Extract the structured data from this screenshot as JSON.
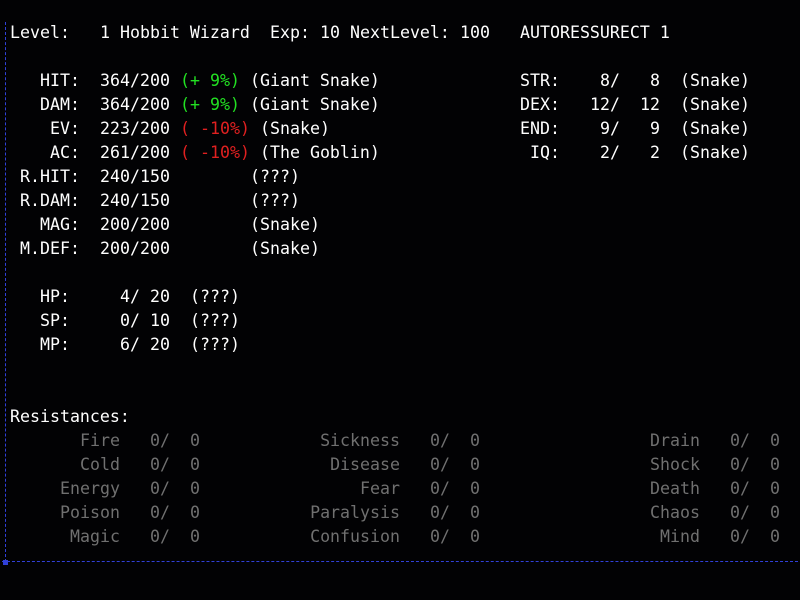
{
  "header": {
    "level_label": "Level:",
    "level_value": "1",
    "race_class": "Hobbit Wizard",
    "exp_label": "Exp:",
    "exp_value": "10",
    "next_label": "NextLevel:",
    "next_value": "100",
    "autores": "AUTORESSURECT 1"
  },
  "combat": [
    {
      "label": "HIT:",
      "cur": "364/",
      "max": "200",
      "mod": "(+ 9%)",
      "mod_color": "green",
      "src": "(Giant Snake)"
    },
    {
      "label": "DAM:",
      "cur": "364/",
      "max": "200",
      "mod": "(+ 9%)",
      "mod_color": "green",
      "src": "(Giant Snake)"
    },
    {
      "label": "EV:",
      "cur": "223/",
      "max": "200",
      "mod": "( -10%)",
      "mod_color": "red",
      "src": "(Snake)"
    },
    {
      "label": "AC:",
      "cur": "261/",
      "max": "200",
      "mod": "( -10%)",
      "mod_color": "red",
      "src": "(The Goblin)"
    },
    {
      "label": "R.HIT:",
      "cur": "240/",
      "max": "150",
      "mod": "",
      "mod_color": "",
      "src": "(???)"
    },
    {
      "label": "R.DAM:",
      "cur": "240/",
      "max": "150",
      "mod": "",
      "mod_color": "",
      "src": "(???)"
    },
    {
      "label": "MAG:",
      "cur": "200/",
      "max": "200",
      "mod": "",
      "mod_color": "",
      "src": "(Snake)"
    },
    {
      "label": "M.DEF:",
      "cur": "200/",
      "max": "200",
      "mod": "",
      "mod_color": "",
      "src": "(Snake)"
    }
  ],
  "attributes": [
    {
      "label": "STR:",
      "cur": "8/",
      "max": "8",
      "src": "(Snake)"
    },
    {
      "label": "DEX:",
      "cur": "12/",
      "max": "12",
      "src": "(Snake)"
    },
    {
      "label": "END:",
      "cur": "9/",
      "max": "9",
      "src": "(Snake)"
    },
    {
      "label": "IQ:",
      "cur": "2/",
      "max": "2",
      "src": "(Snake)"
    }
  ],
  "vitals": [
    {
      "label": "HP:",
      "cur": "4/",
      "max": "20",
      "src": "(???)"
    },
    {
      "label": "SP:",
      "cur": "0/",
      "max": "10",
      "src": "(???)"
    },
    {
      "label": "MP:",
      "cur": "6/",
      "max": "20",
      "src": "(???)"
    }
  ],
  "resistances_label": "Resistances:",
  "resistances": [
    [
      {
        "name": "Fire",
        "cur": "0/",
        "max": "0"
      },
      {
        "name": "Cold",
        "cur": "0/",
        "max": "0"
      },
      {
        "name": "Energy",
        "cur": "0/",
        "max": "0"
      },
      {
        "name": "Poison",
        "cur": "0/",
        "max": "0"
      },
      {
        "name": "Magic",
        "cur": "0/",
        "max": "0"
      }
    ],
    [
      {
        "name": "Sickness",
        "cur": "0/",
        "max": "0"
      },
      {
        "name": "Disease",
        "cur": "0/",
        "max": "0"
      },
      {
        "name": "Fear",
        "cur": "0/",
        "max": "0"
      },
      {
        "name": "Paralysis",
        "cur": "0/",
        "max": "0"
      },
      {
        "name": "Confusion",
        "cur": "0/",
        "max": "0"
      }
    ],
    [
      {
        "name": "Drain",
        "cur": "0/",
        "max": "0"
      },
      {
        "name": "Shock",
        "cur": "0/",
        "max": "0"
      },
      {
        "name": "Death",
        "cur": "0/",
        "max": "0"
      },
      {
        "name": "Chaos",
        "cur": "0/",
        "max": "0"
      },
      {
        "name": "Mind",
        "cur": "0/",
        "max": "0"
      }
    ]
  ],
  "colors": {
    "border": "#3040d8",
    "positive": "#22e022",
    "negative": "#e02020",
    "dim": "#707070",
    "text": "#ffffff",
    "background": "#020204"
  }
}
